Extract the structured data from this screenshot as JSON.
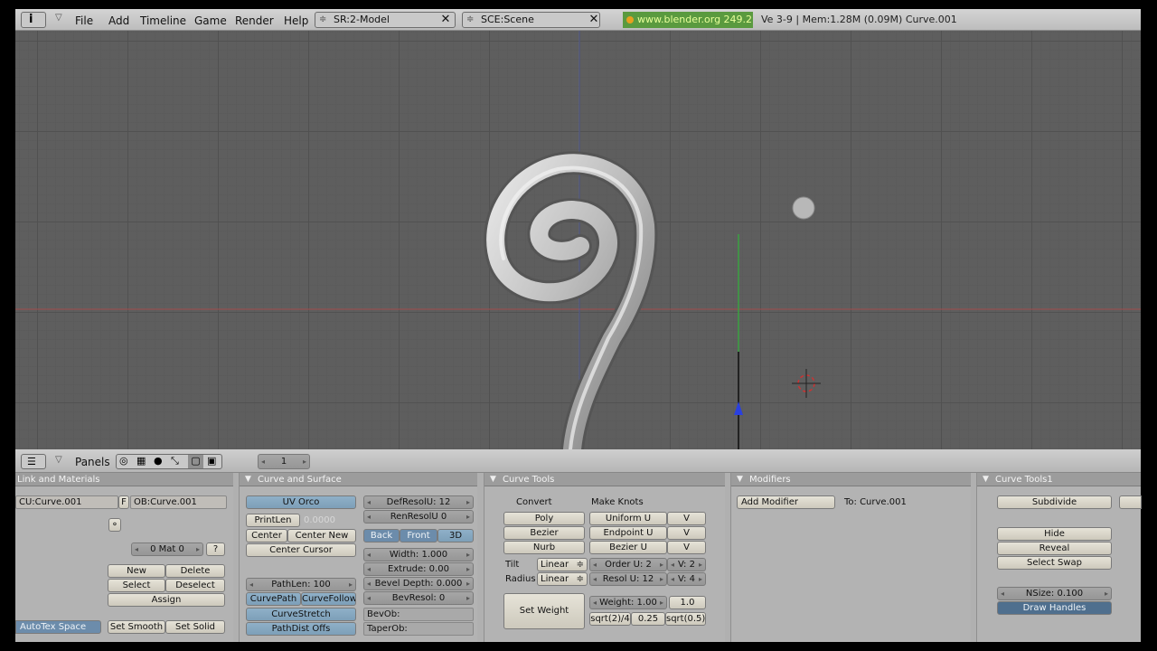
{
  "topbar": {
    "menus": [
      "File",
      "Add",
      "Timeline",
      "Game",
      "Render",
      "Help"
    ],
    "screen_field": "SR:2-Model",
    "scene_field": "SCE:Scene",
    "url": "www.blender.org 249.2",
    "stats": "Ve 3-9 | Mem:1.28M (0.09M) Curve.001"
  },
  "buttons_header": {
    "panels_label": "Panels",
    "frame_value": "1"
  },
  "link_materials": {
    "title": "Link and Materials",
    "curve_name": "CU:Curve.001",
    "f_label": "F",
    "object_name": "OB:Curve.001",
    "mat_value": "0 Mat 0",
    "question": "?",
    "new": "New",
    "delete": "Delete",
    "select": "Select",
    "deselect": "Deselect",
    "assign": "Assign",
    "autotex": "AutoTex Space",
    "set_smooth": "Set Smooth",
    "set_solid": "Set Solid"
  },
  "curve_surface": {
    "title": "Curve and Surface",
    "uv_orco": "UV Orco",
    "printlen": "PrintLen",
    "printlen_value": "0.0000",
    "center": "Center",
    "center_new": "Center New",
    "center_cursor": "Center Cursor",
    "defresolu": "DefResolU: 12",
    "renresolu": "RenResolU 0",
    "back": "Back",
    "front": "Front",
    "three_d": "3D",
    "width": "Width: 1.000",
    "extrude": "Extrude: 0.00",
    "bevel_depth": "Bevel Depth: 0.000",
    "bevresol": "BevResol: 0",
    "bevob": "BevOb:",
    "taperob": "TaperOb:",
    "pathlen": "PathLen: 100",
    "curvepath": "CurvePath",
    "curvefollow": "CurveFollow",
    "curvestretch": "CurveStretch",
    "pathdist": "PathDist Offs"
  },
  "curve_tools": {
    "title": "Curve Tools",
    "convert": "Convert",
    "make_knots": "Make Knots",
    "poly": "Poly",
    "bezier": "Bezier",
    "nurb": "Nurb",
    "uniform_u": "Uniform U",
    "endpoint_u": "Endpoint U",
    "bezier_u": "Bezier U",
    "v": "V",
    "tilt_label": "Tilt",
    "radius_label": "Radius",
    "tilt_value": "Linear",
    "radius_value": "Linear",
    "order_u": "Order U: 2",
    "order_v": "V: 2",
    "resol_u": "Resol U: 12",
    "resol_v": "V: 4",
    "set_weight": "Set Weight",
    "weight": "Weight: 1.00",
    "w_1": "1.0",
    "w_sqrt2_4": "sqrt(2)/4",
    "w_025": "0.25",
    "w_sqrt05": "sqrt(0.5)"
  },
  "modifiers": {
    "title": "Modifiers",
    "add_modifier": "Add Modifier",
    "to_label": "To: Curve.001"
  },
  "curve_tools1": {
    "title": "Curve Tools1",
    "subdivide": "Subdivide",
    "hide": "Hide",
    "reveal": "Reveal",
    "select_swap": "Select Swap",
    "nsize": "NSize: 0.100",
    "draw_handles": "Draw Handles"
  },
  "colors": {
    "viewport_bg": "#5e5e5e",
    "red_axis": "#b04a4a",
    "green_axis": "#3aa040",
    "blue_axis": "#2a40e0",
    "url_bg": "#5a9a3f",
    "selected_blue": "#6c8cab"
  }
}
